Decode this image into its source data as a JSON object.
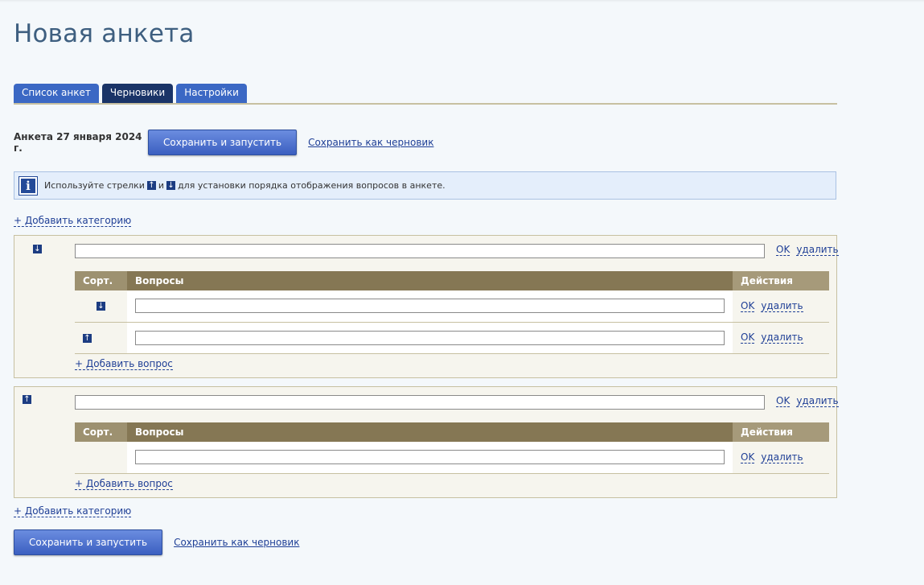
{
  "page": {
    "title": "Новая анкета"
  },
  "tabs": [
    {
      "label": "Список анкет",
      "active": false
    },
    {
      "label": "Черновики",
      "active": true
    },
    {
      "label": "Настройки",
      "active": false
    }
  ],
  "form": {
    "date_label": "Анкета 27 января 2024 г.",
    "save_run_label": "Сохранить и запустить",
    "save_draft_label": "Сохранить как черновик"
  },
  "info": {
    "icon": "info-icon",
    "text_before": "Используйте стрелки",
    "text_and": "и",
    "text_after": "для установки порядка отображения вопросов в анкете.",
    "arrow_up": "↑",
    "arrow_down": "↓"
  },
  "labels": {
    "add_category": "+ Добавить категорию",
    "add_question": "+ Добавить вопрос",
    "ok": "OK",
    "delete": "удалить",
    "col_sort": "Сорт.",
    "col_questions": "Вопросы",
    "col_actions": "Действия"
  },
  "categories": [
    {
      "arrow": "↓",
      "name_value": "",
      "questions": [
        {
          "arrow": "↓",
          "value": ""
        },
        {
          "arrow": "↑",
          "value": ""
        }
      ]
    },
    {
      "arrow": "↑",
      "name_value": "",
      "questions": [
        {
          "arrow": "",
          "value": ""
        }
      ]
    }
  ],
  "colors": {
    "tab": "#3b68c4",
    "tab_active": "#1a3467",
    "table_header": "#857754",
    "border": "#c7c0a1",
    "link": "#1f3f96"
  }
}
